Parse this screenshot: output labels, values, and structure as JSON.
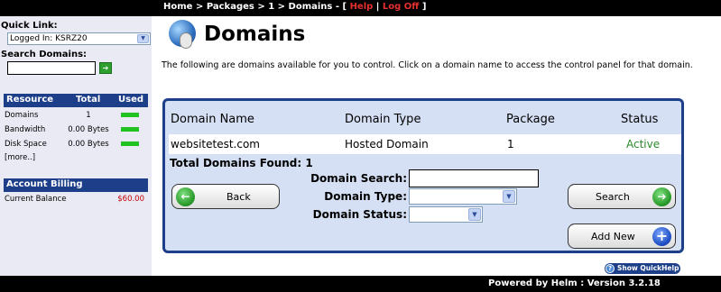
{
  "breadcrumb": {
    "home": "Home",
    "sep": ">",
    "packages": "Packages",
    "package_id": "1",
    "domains": "Domains",
    "dash": "-",
    "open": "[",
    "help": "Help",
    "pipe": "|",
    "logoff": "Log Off",
    "close": "]"
  },
  "sidebar": {
    "quick_link_label": "Quick Link:",
    "quick_link_value": "Logged In: KSRZ20",
    "search_domains_label": "Search Domains:",
    "search_go": "➔",
    "resource_header": {
      "resource": "Resource",
      "total": "Total",
      "used": "Used"
    },
    "resources": [
      {
        "name": "Domains",
        "total": "1"
      },
      {
        "name": "Bandwidth",
        "total": "0.00 Bytes"
      },
      {
        "name": "Disk Space",
        "total": "0.00 Bytes"
      }
    ],
    "more": "[more..]",
    "billing_header": "Account Billing",
    "billing_label": "Current Balance",
    "billing_amount": "$60.00"
  },
  "main": {
    "title": "Domains",
    "intro": "The following are domains available for you to control. Click on a domain name to access the control panel for that domain.",
    "columns": {
      "name": "Domain Name",
      "type": "Domain Type",
      "package": "Package",
      "status": "Status"
    },
    "rows": [
      {
        "name": "websitetest.com",
        "type": "Hosted Domain",
        "package": "1",
        "status": "Active"
      }
    ],
    "total": "Total Domains Found: 1",
    "search_label": "Domain Search:",
    "type_label": "Domain Type:",
    "status_label": "Domain Status:",
    "back_label": "Back",
    "back_icon": "←",
    "search_button": "Search",
    "search_icon": "➔",
    "add_new": "Add New",
    "add_icon": "+",
    "quickhelp": "Show QuickHelp",
    "quickhelp_icon": "?"
  },
  "footer": "Powered by Helm : Version 3.2.18",
  "colors": {
    "navy": "#1d3f8a",
    "panel": "#d5e0f5",
    "used_bar": "#1fc21f",
    "balance": "#c00000",
    "status_active": "#2a8a2a"
  }
}
